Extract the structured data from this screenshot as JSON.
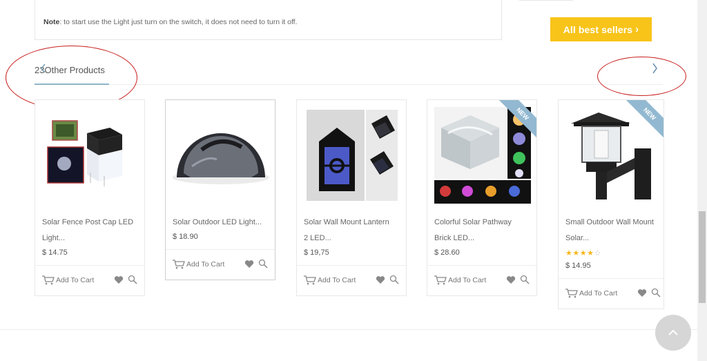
{
  "note": {
    "label": "Note",
    "text": ": to start use the Light just turn on the switch, it does not need to turn it off."
  },
  "best_sellers": {
    "label": "All best sellers",
    "chevron": "›"
  },
  "section": {
    "count": "23",
    "title": "Other Products",
    "next_icon": "›"
  },
  "colors": {
    "accent_yellow": "#f8c41a",
    "new_ribbon": "#92b9d1",
    "annotation_red": "#c8201e"
  },
  "products": [
    {
      "name_line1": "Solar Fence Post Cap LED",
      "name_line2": "Light...",
      "price": "$ 14.75",
      "cart_label": "Add To Cart",
      "new": false
    },
    {
      "name_line1": "Solar Outdoor LED Light...",
      "name_line2": "",
      "price": "$ 18.90",
      "cart_label": "Add To Cart",
      "new": false
    },
    {
      "name_line1": "Solar Wall Mount Lantern",
      "name_line2": "2 LED...",
      "price": "$ 19,75",
      "cart_label": "Add To Cart",
      "new": false
    },
    {
      "name_line1": "Colorful Solar Pathway",
      "name_line2": "Brick LED...",
      "price": "$ 28.60",
      "cart_label": "Add To Cart",
      "new": true,
      "badge": "NEW"
    },
    {
      "name_line1": "Small Outdoor Wall Mount",
      "name_line2": "Solar...",
      "price": "$ 14.95",
      "cart_label": "Add To Cart",
      "new": true,
      "badge": "NEW",
      "rating": {
        "stars": 4,
        "max": 5,
        "filled": "★★★★",
        "empty": "☆"
      }
    }
  ],
  "icons": {
    "cart": "cart-icon",
    "wishlist": "heart-icon",
    "quick_view": "zoom-icon",
    "back_to_top": "chevron-up-icon"
  }
}
